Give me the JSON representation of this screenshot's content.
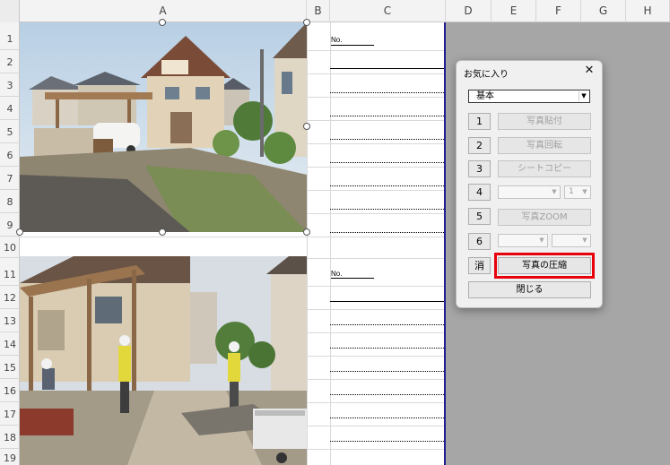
{
  "sheet": {
    "columns": [
      "A",
      "B",
      "C",
      "D",
      "E",
      "F",
      "G",
      "H"
    ],
    "rows": [
      "1",
      "2",
      "3",
      "4",
      "5",
      "6",
      "7",
      "8",
      "9",
      "10",
      "11",
      "12",
      "13",
      "14",
      "15",
      "16",
      "17",
      "18",
      "19"
    ]
  },
  "form": {
    "no_label": "No."
  },
  "photos": [
    {
      "subject": "house-exterior-before"
    },
    {
      "subject": "construction-workers"
    }
  ],
  "dialog": {
    "title": "お気に入り",
    "close_glyph": "✕",
    "combo_value": "基本",
    "combo_arrow": "▼",
    "num_buttons": [
      "1",
      "2",
      "3",
      "4",
      "5",
      "6"
    ],
    "clear_label": "消",
    "actions": {
      "paste": "写真貼付",
      "rotate": "写真回転",
      "sheet_copy": "シートコピー",
      "zoom": "写真ZOOM",
      "compress": "写真の圧縮",
      "close": "閉じる"
    },
    "row4_combo2_value": "1",
    "highlight_color": "#e8000b"
  }
}
